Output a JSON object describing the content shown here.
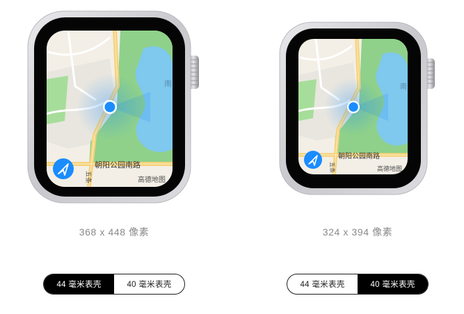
{
  "watches": [
    {
      "caption": "368 x 448 像素",
      "road_label": "朝阳公园南路",
      "side_label": "五条",
      "building_label": "高德地图",
      "edge_label": "南"
    },
    {
      "caption": "324 x 394 像素",
      "road_label": "朝阳公园南路",
      "side_label": "五条",
      "building_label": "高德地图",
      "edge_label": "南"
    }
  ],
  "toggles": [
    {
      "options": [
        "44 毫米表壳",
        "40 毫米表壳"
      ],
      "selected": "44 毫米表壳"
    },
    {
      "options": [
        "44 毫米表壳",
        "40 毫米表壳"
      ],
      "selected": "40 毫米表壳"
    }
  ],
  "colors": {
    "location_dot": "#1a8cff",
    "park_green": "#8fd18a",
    "water_blue": "#7fc8ee",
    "road_yellow": "#f6d27a",
    "case_silver": "#d8d8dc"
  },
  "icons": {
    "locate_button": "location-arrow-icon",
    "digital_crown": "digital-crown"
  }
}
